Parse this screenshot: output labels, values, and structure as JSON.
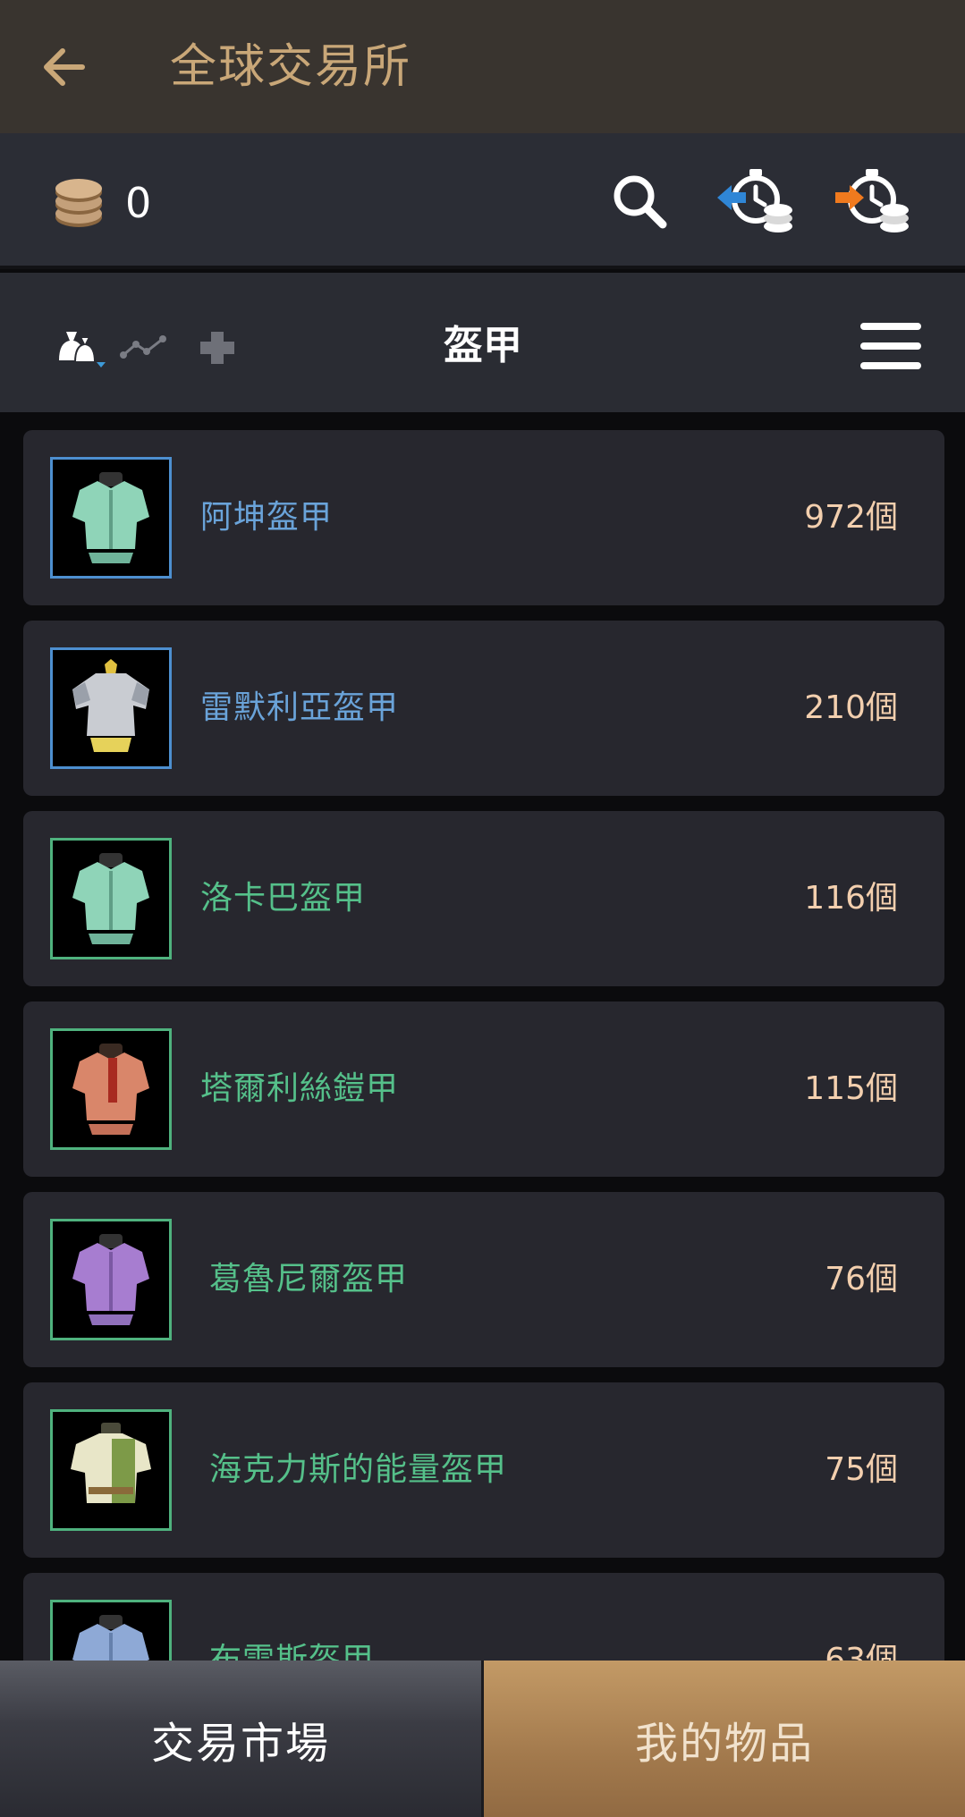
{
  "header": {
    "title": "全球交易所",
    "back_icon": "arrow-left-icon"
  },
  "wallet": {
    "coin_icon": "coin-stack-icon",
    "balance": "0",
    "actions": [
      "search-icon",
      "buy-history-icon",
      "sell-history-icon"
    ]
  },
  "category_bar": {
    "filter_icon": "item-filter-icon",
    "chart_icon": "price-chart-icon",
    "add_icon": "plus-icon",
    "title": "盔甲",
    "menu_icon": "hamburger-menu-icon"
  },
  "items": [
    {
      "name": "阿坤盔甲",
      "count": "972個",
      "grade_color": "#4d8fd0",
      "armor_color": "#8fd4b8"
    },
    {
      "name": "雷默利亞盔甲",
      "count": "210個",
      "grade_color": "#4d8fd0",
      "armor_color": "#c9ccd2"
    },
    {
      "name": "洛卡巴盔甲",
      "count": "116個",
      "grade_color": "#4fb27e",
      "armor_color": "#8fd4b8"
    },
    {
      "name": "塔爾利絲鎧甲",
      "count": "115個",
      "grade_color": "#4fb27e",
      "armor_color": "#d9866a"
    },
    {
      "name": "葛魯尼爾盔甲",
      "count": "76個",
      "grade_color": "#4fb27e",
      "armor_color": "#a77dd0"
    },
    {
      "name": "海克力斯的能量盔甲",
      "count": "75個",
      "grade_color": "#4fb27e",
      "armor_color": "#e8e6c8"
    },
    {
      "name": "布雷斯盔甲",
      "count": "63個",
      "grade_color": "#4fb27e",
      "armor_color": "#8ea9d6"
    }
  ],
  "tabs": {
    "market": "交易市場",
    "my_items": "我的物品"
  },
  "colors": {
    "title_gold": "#c9a778",
    "count_text": "#f3cfae",
    "rare_blue": "#4d8fd0",
    "uncommon_green": "#4fb27e",
    "buy_arrow": "#2f86d6",
    "sell_arrow": "#f07a1e"
  }
}
